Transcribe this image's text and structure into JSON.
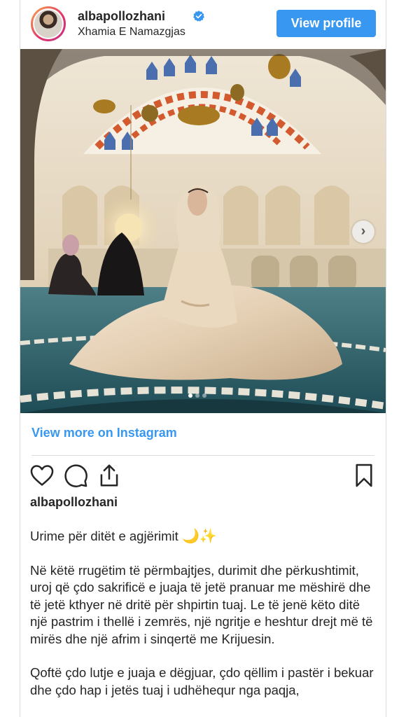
{
  "header": {
    "username": "albapollozhani",
    "location": "Xhamia E Namazgjas",
    "view_profile_label": "View profile"
  },
  "carousel": {
    "total": 3,
    "active_index": 0,
    "next_symbol": "›"
  },
  "view_more_label": "View more on Instagram",
  "post": {
    "username": "albapollozhani",
    "caption": {
      "line1_text": "Urime për ditët e agjërimit",
      "line1_emojis": [
        "🌙",
        "✨"
      ],
      "paragraph2": "Në këtë rrugëtim të përmbajtjes, durimit dhe përkushtimit, uroj që çdo sakrificë e juaja të jetë pranuar me mëshirë dhe të jetë kthyer në dritë për shpirtin tuaj. Le të jenë këto ditë një pastrim i thellë i zemrës, një ngritje e heshtur drejt më të mirës dhe një afrim i sinqertë me Krijuesin.",
      "paragraph3": "Qoftë çdo lutje e juaja e dëgjuar, çdo qëllim i pastër i bekuar dhe çdo hap i jetës tuaj i udhëhequr nga paqja,"
    }
  },
  "icons": {
    "verified": "verified-badge-icon",
    "like": "heart-icon",
    "comment": "comment-icon",
    "share": "share-icon",
    "save": "bookmark-icon",
    "next": "chevron-right-icon"
  },
  "colors": {
    "accent": "#3897f0",
    "text": "#262626",
    "border": "#dbdbdb"
  }
}
